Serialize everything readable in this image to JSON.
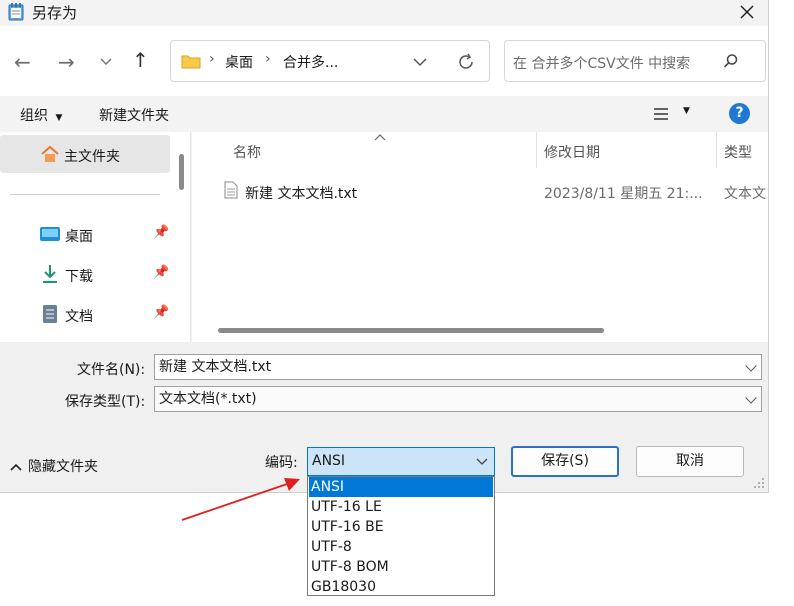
{
  "window": {
    "title": "另存为",
    "close_icon": "close-icon"
  },
  "toolbar": {
    "breadcrumb": [
      "桌面",
      "合并多..."
    ],
    "search_placeholder": "在 合并多个CSV文件 中搜索"
  },
  "cmdbar": {
    "organize": "组织",
    "new_folder": "新建文件夹",
    "help": "?"
  },
  "sidebar": {
    "home": "主文件夹",
    "items": [
      {
        "label": "桌面",
        "icon": "desktop-icon"
      },
      {
        "label": "下载",
        "icon": "download-icon"
      },
      {
        "label": "文档",
        "icon": "documents-icon"
      }
    ]
  },
  "files": {
    "columns": [
      "名称",
      "修改日期",
      "类型"
    ],
    "rows": [
      {
        "name": "新建 文本文档.txt",
        "date": "2023/8/11 星期五 21:...",
        "type": "文本文"
      }
    ]
  },
  "form": {
    "filename_label": "文件名(N):",
    "filename_value": "新建 文本文档.txt",
    "filetype_label": "保存类型(T):",
    "filetype_value": "文本文档(*.txt)",
    "hide_folders": "隐藏文件夹",
    "encoding_label": "编码:",
    "encoding_value": "ANSI",
    "encoding_options": [
      "ANSI",
      "UTF-16 LE",
      "UTF-16 BE",
      "UTF-8",
      "UTF-8 BOM",
      "GB18030"
    ],
    "save": "保存(S)",
    "cancel": "取消"
  },
  "colors": {
    "accent": "#0078d7",
    "annotation_arrow": "#e02020",
    "help_blue": "#1e78d4"
  }
}
